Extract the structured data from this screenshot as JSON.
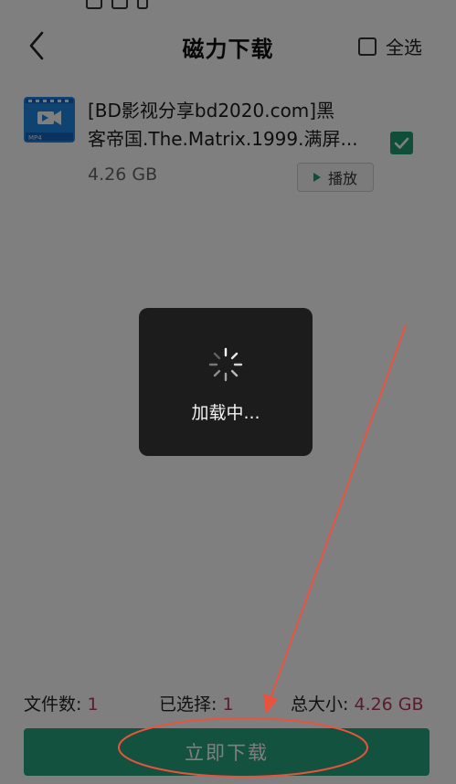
{
  "header": {
    "title": "磁力下载",
    "select_all_label": "全选",
    "select_all_checked": false
  },
  "file": {
    "name_line1": "[BD影视分享bd2020.com]黑",
    "name_line2": "客帝国.The.Matrix.1999.满屏...",
    "icon_badge": "MP4",
    "size": "4.26 GB",
    "play_label": "播放",
    "checked": true
  },
  "footer": {
    "file_count_label": "文件数:",
    "file_count_value": "1",
    "selected_label": "已选择:",
    "selected_value": "1",
    "total_size_label": "总大小:",
    "total_size_value": "4.26 GB",
    "download_label": "立即下载"
  },
  "toast": {
    "text": "加载中..."
  },
  "colors": {
    "accent": "#26a57c",
    "value_highlight": "#b53a5a",
    "annotation": "#e8533e"
  }
}
